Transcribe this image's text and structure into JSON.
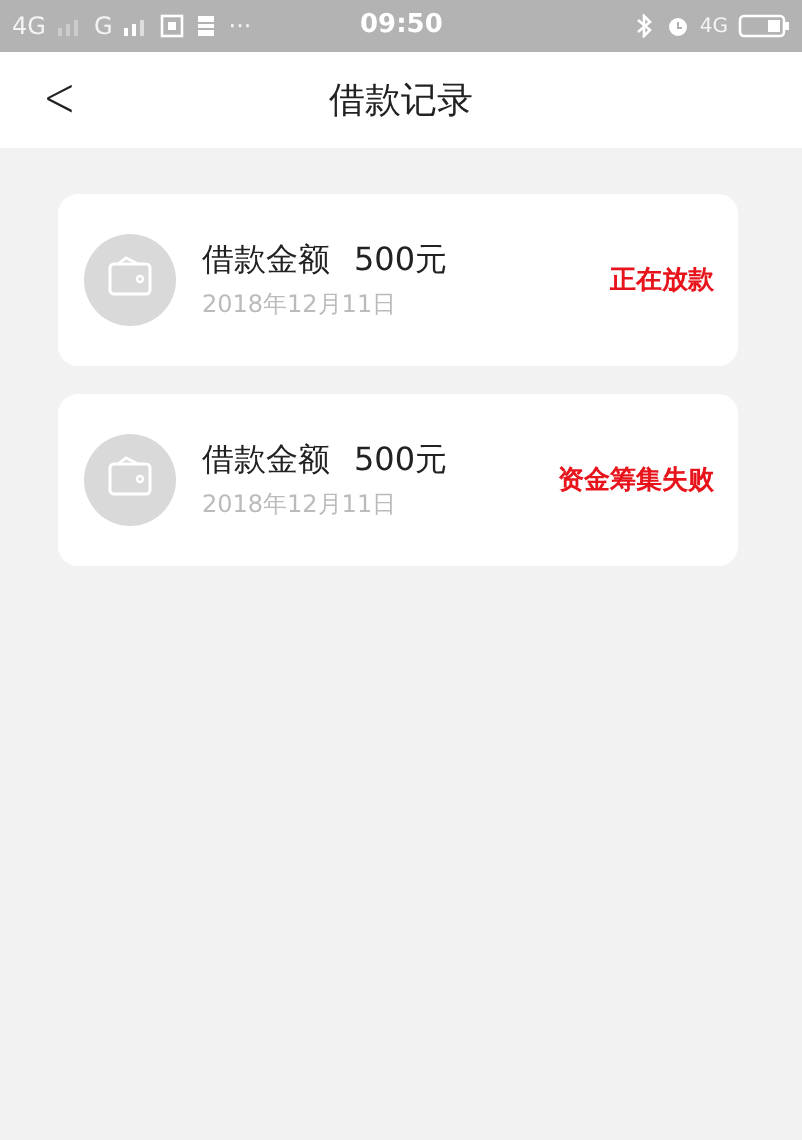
{
  "status_bar": {
    "network_1": "4G",
    "network_2": "G",
    "more": "···",
    "time": "09:50",
    "network_3": "4G"
  },
  "header": {
    "back": "<",
    "title": "借款记录"
  },
  "records": [
    {
      "label": "借款金额",
      "amount": "500元",
      "date": "2018年12月11日",
      "status": "正在放款"
    },
    {
      "label": "借款金额",
      "amount": "500元",
      "date": "2018年12月11日",
      "status": "资金筹集失败"
    }
  ]
}
